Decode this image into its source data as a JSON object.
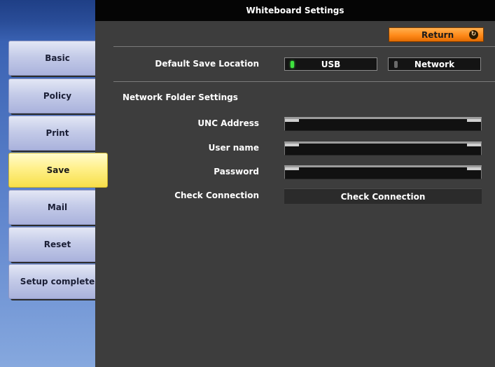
{
  "window": {
    "title": "Whiteboard Settings"
  },
  "sidebar": {
    "items": [
      {
        "label": "Basic"
      },
      {
        "label": "Policy"
      },
      {
        "label": "Print"
      },
      {
        "label": "Save",
        "active": true
      },
      {
        "label": "Mail"
      },
      {
        "label": "Reset"
      },
      {
        "label": "Setup complete"
      }
    ]
  },
  "toolbar": {
    "return_label": "Return",
    "return_icon": "return-circle-icon"
  },
  "save_location": {
    "label": "Default Save Location",
    "options": [
      {
        "label": "USB",
        "selected": true
      },
      {
        "label": "Network",
        "selected": false
      }
    ]
  },
  "network_folder": {
    "section_title": "Network Folder Settings",
    "unc_label": "UNC Address",
    "unc_value": "",
    "user_label": "User name",
    "user_value": "",
    "password_label": "Password",
    "password_value": "",
    "check_label": "Check Connection",
    "check_button": "Check Connection"
  },
  "colors": {
    "accent": "#ff8a1a",
    "active_tab": "#f7df4a",
    "indicator_on": "#3fe23f",
    "panel_bg": "#3d3d3d",
    "sidebar_bg": "#5f85cd"
  }
}
